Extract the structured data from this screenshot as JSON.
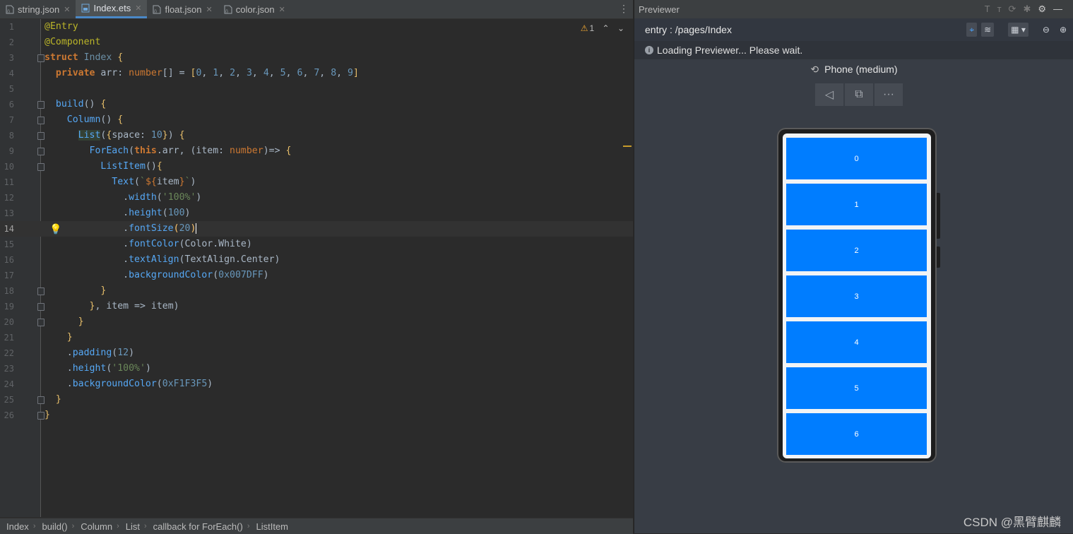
{
  "tabs": [
    {
      "label": "string.json",
      "active": false
    },
    {
      "label": "Index.ets",
      "active": true
    },
    {
      "label": "float.json",
      "active": false
    },
    {
      "label": "color.json",
      "active": false
    }
  ],
  "editor": {
    "warning_count": "1",
    "current_line": 14
  },
  "breadcrumbs": [
    "Index",
    "build()",
    "Column",
    "List",
    "callback for ForEach()",
    "ListItem"
  ],
  "previewer": {
    "title": "Previewer",
    "path": "entry : /pages/Index",
    "loading": "Loading Previewer... Please wait.",
    "device": "Phone (medium)",
    "list_items": [
      "0",
      "1",
      "2",
      "3",
      "4",
      "5",
      "6"
    ],
    "item_color": "#007DFF",
    "screen_bg": "#F1F3F5"
  },
  "watermark": "CSDN @黑臂麒麟",
  "colors": {
    "keyword": "#cc7832",
    "annotation": "#bbb529",
    "number": "#6897bb",
    "string": "#6a8759",
    "accent": "#4a88c7"
  }
}
